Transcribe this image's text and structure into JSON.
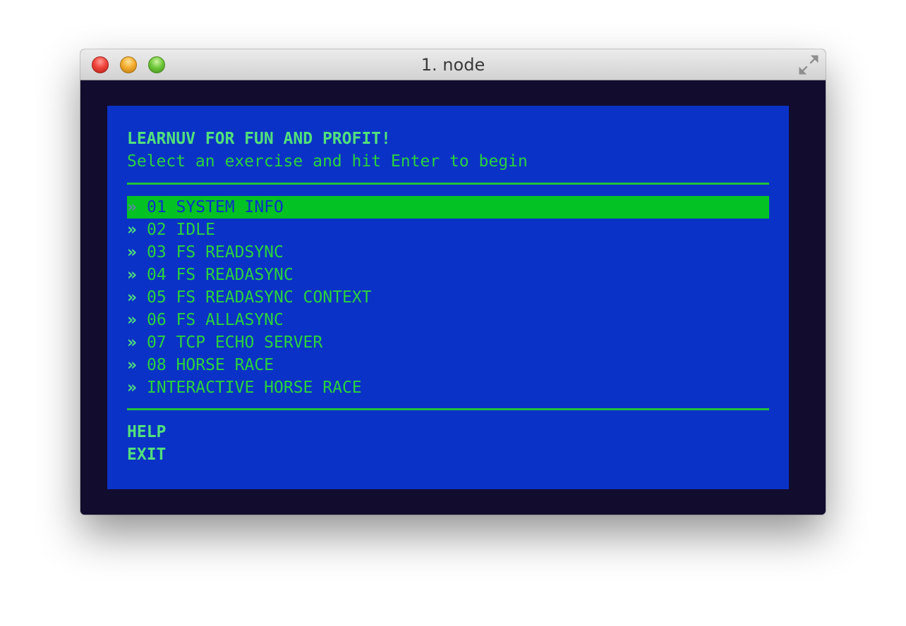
{
  "window": {
    "title": "1. node"
  },
  "app": {
    "heading": "LEARNUV FOR FUN AND PROFIT!",
    "subheading": "Select an exercise and hit Enter to begin",
    "bullet": "»",
    "menu": [
      {
        "label": "01 SYSTEM INFO",
        "selected": true
      },
      {
        "label": "02 IDLE",
        "selected": false
      },
      {
        "label": "03 FS READSYNC",
        "selected": false
      },
      {
        "label": "04 FS READASYNC",
        "selected": false
      },
      {
        "label": "05 FS READASYNC CONTEXT",
        "selected": false
      },
      {
        "label": "06 FS ALLASYNC",
        "selected": false
      },
      {
        "label": "07 TCP ECHO SERVER",
        "selected": false
      },
      {
        "label": "08 HORSE RACE",
        "selected": false
      },
      {
        "label": "INTERACTIVE HORSE RACE",
        "selected": false
      }
    ],
    "help_label": "HELP",
    "exit_label": "EXIT"
  },
  "colors": {
    "terminal_background": "#120c2e",
    "panel_background": "#0b32c6",
    "text_green": "#2ad23e",
    "bright_green": "#52e07c",
    "selection_background": "#02c224"
  },
  "icons": {
    "fullscreen": "fullscreen-icon"
  }
}
